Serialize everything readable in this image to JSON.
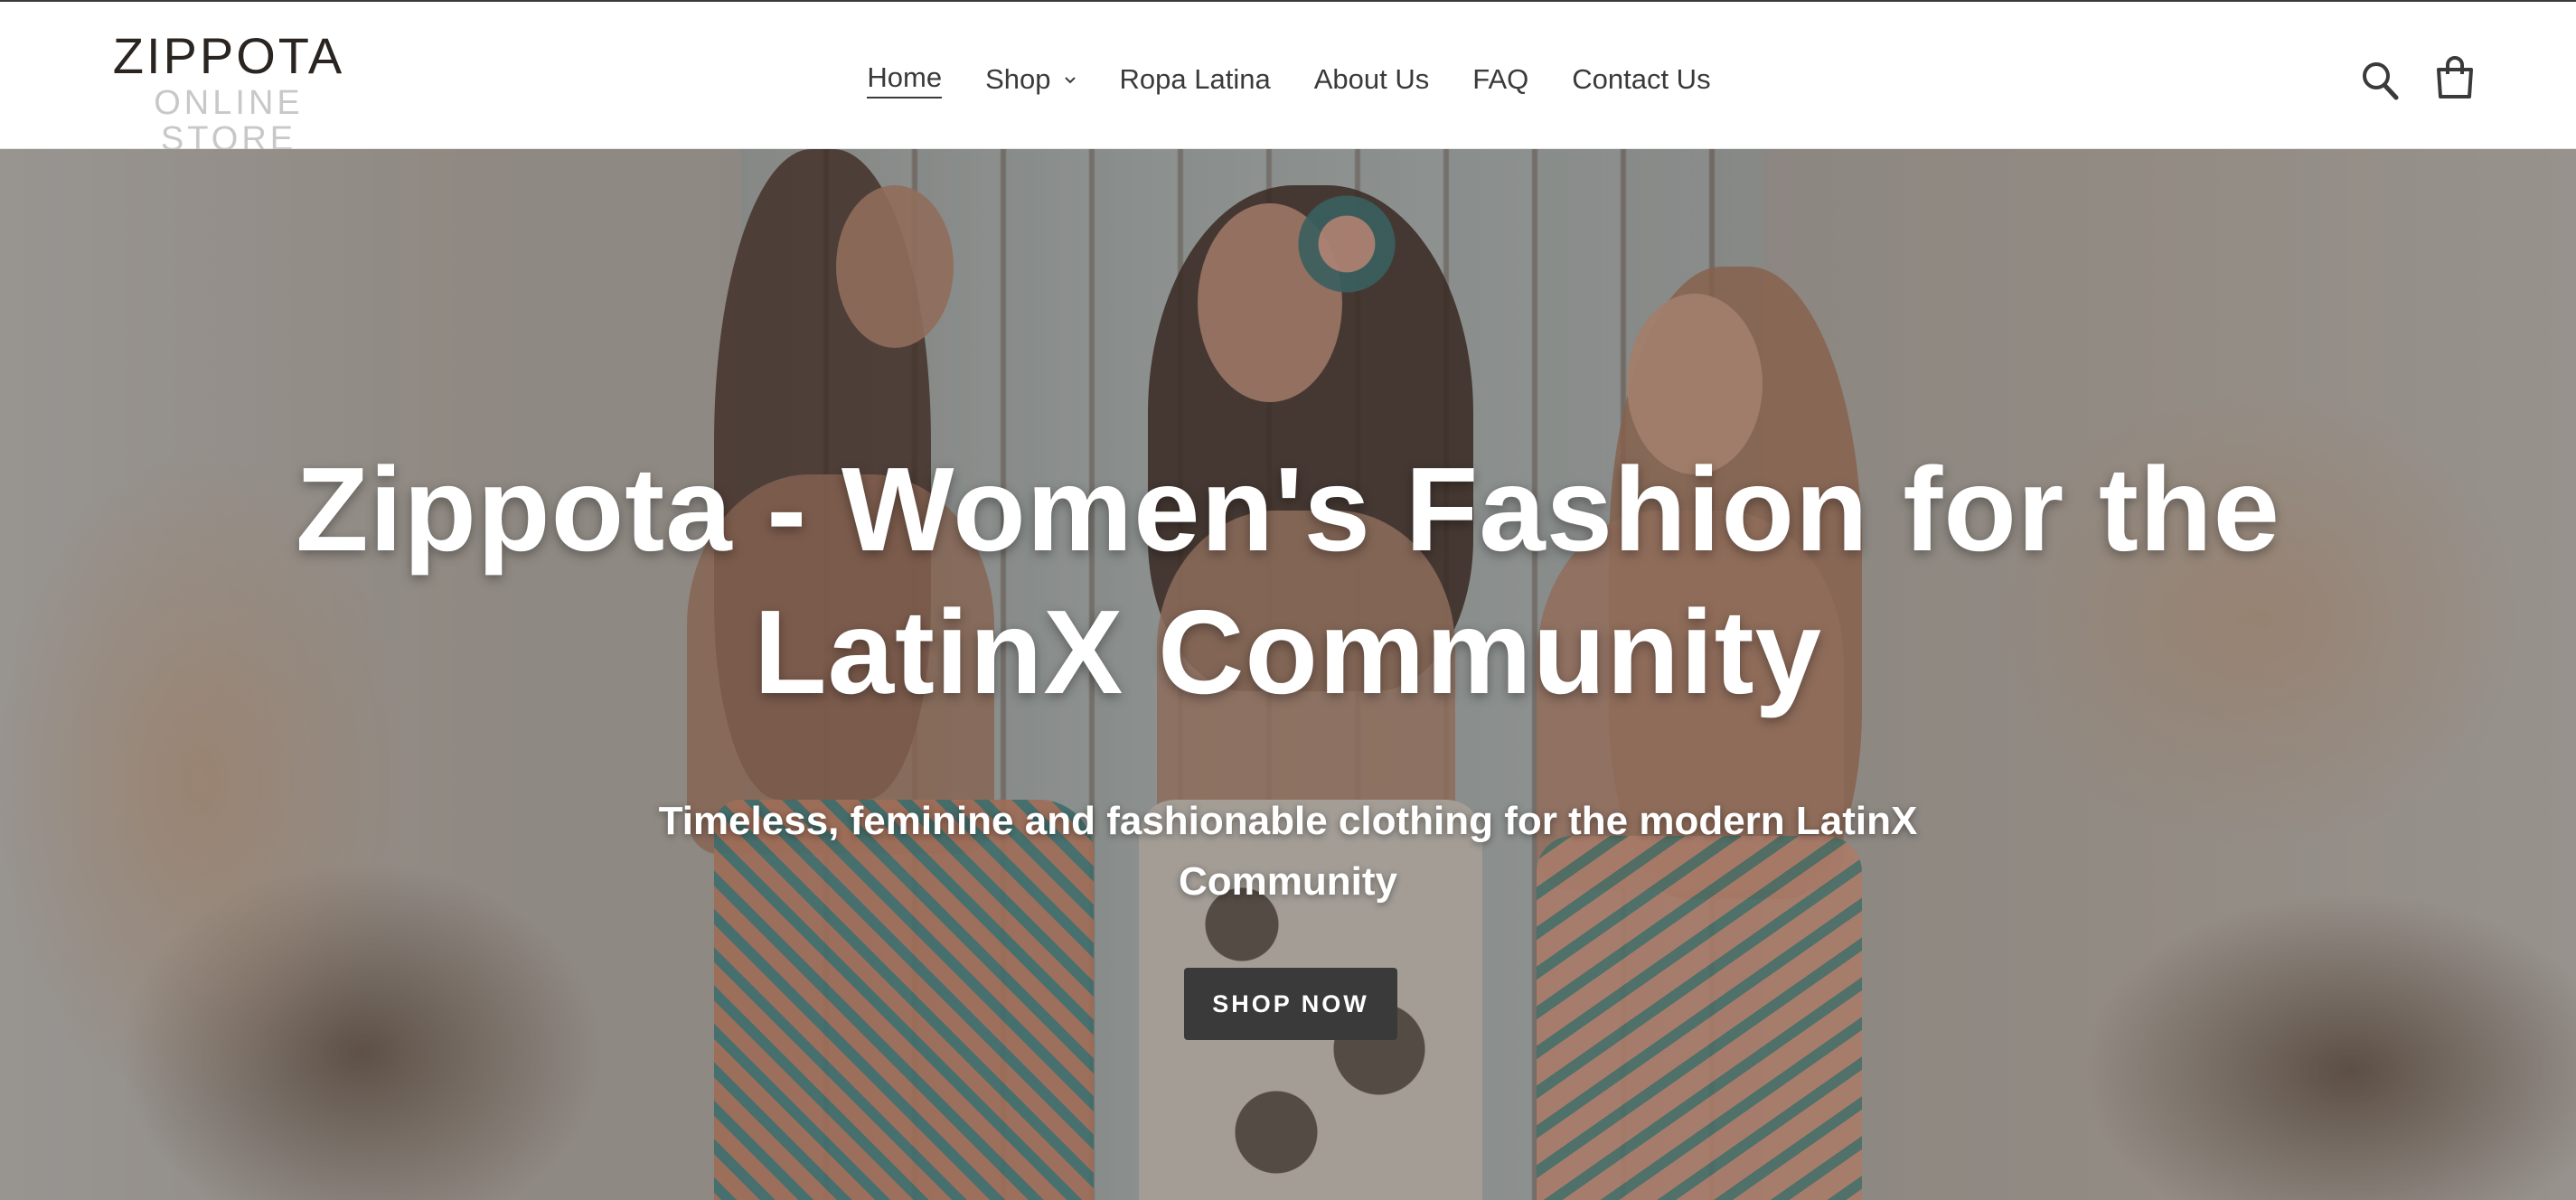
{
  "header": {
    "logo": {
      "main": "ZIPPOTA",
      "sub": "ONLINE STORE"
    },
    "nav": [
      {
        "label": "Home",
        "active": true
      },
      {
        "label": "Shop",
        "has_dropdown": true
      },
      {
        "label": "Ropa Latina"
      },
      {
        "label": "About Us"
      },
      {
        "label": "FAQ"
      },
      {
        "label": "Contact Us"
      }
    ],
    "icons": {
      "search": "search-icon",
      "cart": "shopping-bag-icon",
      "dropdown": "chevron-down-icon"
    }
  },
  "hero": {
    "title": "Zippota - Women's Fashion for the LatinX Community",
    "subtitle": "Timeless, feminine and fashionable clothing for the modern LatinX Community",
    "cta_label": "SHOP NOW"
  },
  "colors": {
    "text": "#3a3a3a",
    "button_bg": "#3a3a3a",
    "button_text": "#ffffff",
    "logo_main": "#2b2521",
    "logo_sub": "#c8c8c8",
    "hero_text": "#ffffff"
  }
}
